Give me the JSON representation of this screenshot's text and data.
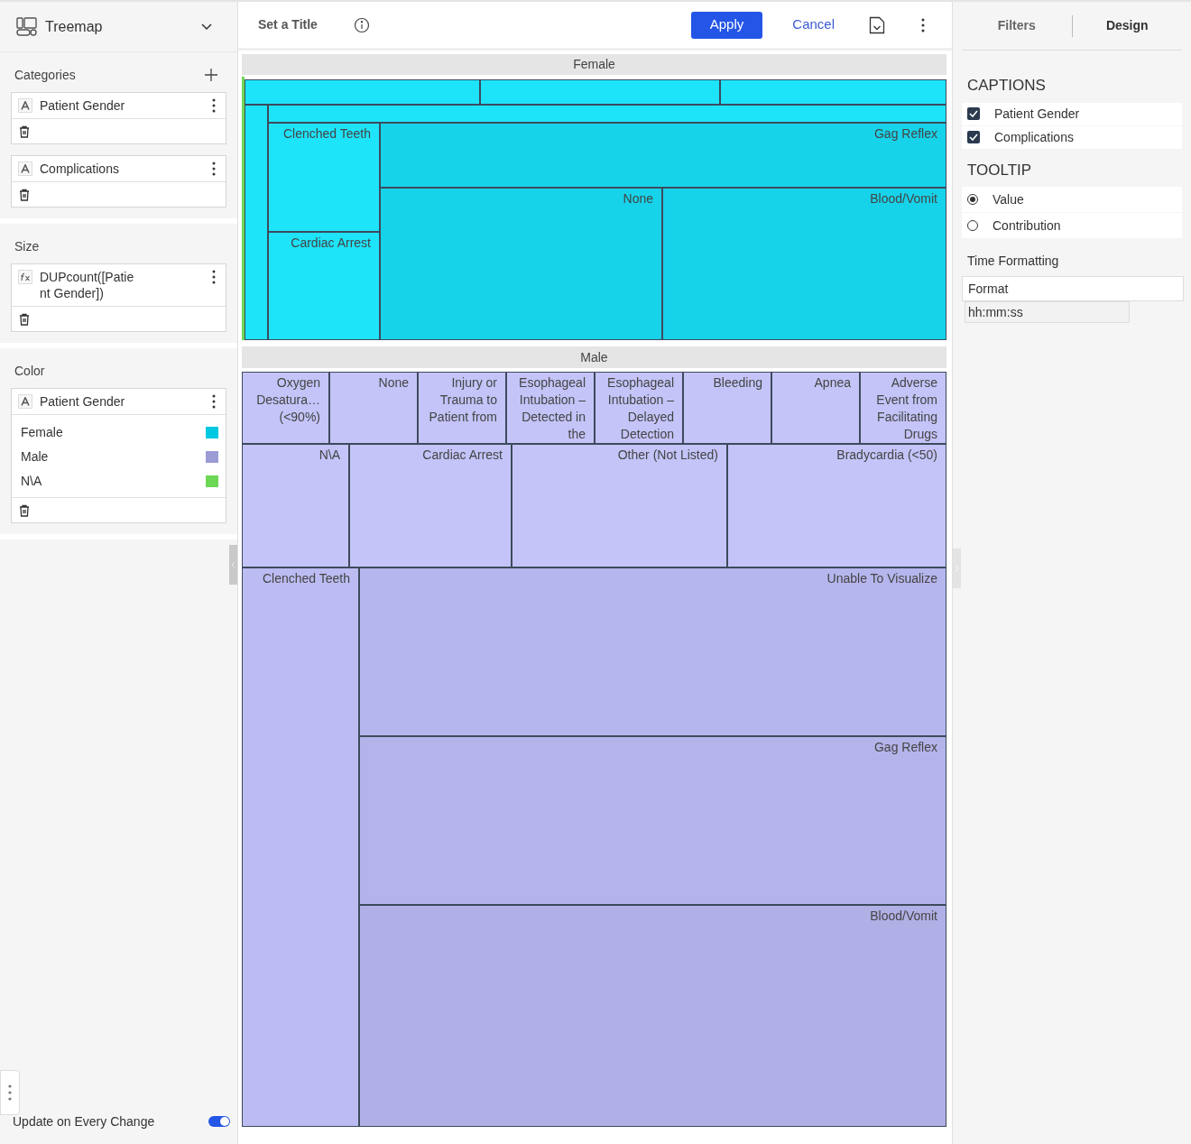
{
  "chart_picker": {
    "label": "Treemap"
  },
  "left_panel": {
    "sections": [
      {
        "title": "Categories",
        "can_add": true,
        "fields": [
          {
            "kind": "text",
            "name": "Patient Gender"
          },
          {
            "kind": "text",
            "name": "Complications"
          }
        ]
      },
      {
        "title": "Size",
        "can_add": false,
        "fields": [
          {
            "kind": "formula",
            "name": "DUPcount([Patient Gender])"
          }
        ]
      },
      {
        "title": "Color",
        "can_add": false,
        "fields": [
          {
            "kind": "text",
            "name": "Patient Gender",
            "legend": [
              {
                "label": "Female",
                "color": "#00c8e0"
              },
              {
                "label": "Male",
                "color": "#9b9bd6"
              },
              {
                "label": "N\\A",
                "color": "#6cd855"
              }
            ]
          }
        ]
      }
    ],
    "update_toggle": {
      "label": "Update on Every Change",
      "on": true
    }
  },
  "toolbar": {
    "title": "Set a Title",
    "apply": "Apply",
    "cancel": "Cancel"
  },
  "treemap": {
    "groups": [
      {
        "label": "Female",
        "tiles": [
          "Clenched Teeth",
          "Cardiac Arrest",
          "Gag Reflex",
          "None",
          "Blood/Vomit"
        ]
      },
      {
        "label": "Male",
        "tiles": [
          "Oxygen Desatura… (<90%)",
          "None",
          "Injury or Trauma to Patient from",
          "Esophageal Intubation – Detected in the",
          "Esophageal Intubation – Delayed Detection",
          "Bleeding",
          "Apnea",
          "Adverse Event from Facilitating Drugs",
          "N\\A",
          "Cardiac Arrest",
          "Other (Not Listed)",
          "Bradycardia (<50)",
          "Clenched Teeth",
          "Unable To Visualize",
          "Gag Reflex",
          "Blood/Vomit"
        ]
      }
    ]
  },
  "right_panel": {
    "tabs": [
      {
        "label": "Filters",
        "selected": false
      },
      {
        "label": "Design",
        "selected": true
      }
    ],
    "captions": {
      "title": "CAPTIONS",
      "items": [
        {
          "label": "Patient Gender",
          "checked": true
        },
        {
          "label": "Complications",
          "checked": true
        }
      ]
    },
    "tooltip": {
      "title": "TOOLTIP",
      "options": [
        {
          "label": "Value",
          "selected": true
        },
        {
          "label": "Contribution",
          "selected": false
        }
      ]
    },
    "time_formatting": {
      "title": "Time Formatting",
      "field": "Format",
      "options": [
        "hh:mm:ss"
      ]
    }
  }
}
